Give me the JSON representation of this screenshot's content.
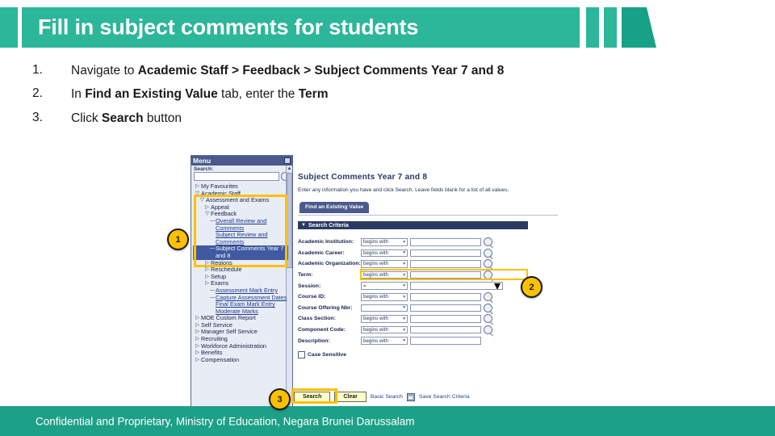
{
  "header": {
    "title": "Fill in subject comments for students",
    "brand_color": "#2cb69a",
    "accent_color": "#17a287"
  },
  "steps": [
    {
      "num": "1.",
      "html": "Navigate to <b>Academic Staff &gt; Feedback &gt; Subject Comments Year 7 and 8</b>"
    },
    {
      "num": "2.",
      "html": "In <b>Find an Existing Value</b> tab, enter the <b>Term</b>"
    },
    {
      "num": "3.",
      "html": "Click <b>Search</b> button"
    }
  ],
  "callouts": [
    {
      "label": "1"
    },
    {
      "label": "2"
    },
    {
      "label": "3"
    }
  ],
  "app": {
    "menu": {
      "title": "Menu",
      "search_label": "Search:",
      "search_value": "",
      "items": [
        {
          "label": "My Favourites",
          "glyph": "▷",
          "indent": 0,
          "style": "plain"
        },
        {
          "label": "Academic Staff",
          "glyph": "▽",
          "indent": 0,
          "style": "plain"
        },
        {
          "label": "Assessment and Exams",
          "glyph": "▽",
          "indent": 1,
          "style": "plain"
        },
        {
          "label": "Appeal",
          "glyph": "▷",
          "indent": 2,
          "style": "plain"
        },
        {
          "label": "Feedback",
          "glyph": "▽",
          "indent": 2,
          "style": "plain"
        },
        {
          "label": "Overall Review and Comments",
          "glyph": "—",
          "indent": 3,
          "style": "link"
        },
        {
          "label": "Subject Review and Comments",
          "glyph": "",
          "indent": 3,
          "style": "link"
        },
        {
          "label": "Subject Comments Year 7 and 8",
          "glyph": "—",
          "indent": 3,
          "style": "sel"
        },
        {
          "label": "Regions",
          "glyph": "▷",
          "indent": 2,
          "style": "plain"
        },
        {
          "label": "Reschedule",
          "glyph": "▷",
          "indent": 2,
          "style": "plain"
        },
        {
          "label": "Setup",
          "glyph": "▷",
          "indent": 2,
          "style": "plain"
        },
        {
          "label": "Exams",
          "glyph": "▷",
          "indent": 2,
          "style": "plain"
        },
        {
          "label": "Assessment Mark Entry",
          "glyph": "—",
          "indent": 3,
          "style": "link"
        },
        {
          "label": "Capture Assessment Dates",
          "glyph": "—",
          "indent": 3,
          "style": "link"
        },
        {
          "label": "Final Exam Mark Entry",
          "glyph": "",
          "indent": 3,
          "style": "link"
        },
        {
          "label": "Moderate Marks",
          "glyph": "",
          "indent": 3,
          "style": "link"
        },
        {
          "label": "MOE Custom Report",
          "glyph": "▷",
          "indent": 0,
          "style": "plain"
        },
        {
          "label": "Self Service",
          "glyph": "▷",
          "indent": 0,
          "style": "plain"
        },
        {
          "label": "Manager Self Service",
          "glyph": "▷",
          "indent": 0,
          "style": "plain"
        },
        {
          "label": "Recruiting",
          "glyph": "▷",
          "indent": 0,
          "style": "plain"
        },
        {
          "label": "Workforce Administration",
          "glyph": "▷",
          "indent": 0,
          "style": "plain"
        },
        {
          "label": "Benefits",
          "glyph": "▷",
          "indent": 0,
          "style": "plain"
        },
        {
          "label": "Compensation",
          "glyph": "▷",
          "indent": 0,
          "style": "plain"
        }
      ]
    },
    "content": {
      "title": "Subject Comments Year 7 and 8",
      "instructions": "Enter any information you have and click Search. Leave fields blank for a list of all values.",
      "tab_label": "Find an Existing Value",
      "criteria_header": "Search Criteria",
      "fields": [
        {
          "label": "Academic Institution:",
          "operator": "begins with",
          "value": "",
          "lookup": true,
          "wide": false
        },
        {
          "label": "Academic Career:",
          "operator": "begins with",
          "value": "",
          "lookup": true,
          "wide": false
        },
        {
          "label": "Academic Organization:",
          "operator": "begins with",
          "value": "",
          "lookup": true,
          "wide": false
        },
        {
          "label": "Term:",
          "operator": "begins with",
          "value": "",
          "lookup": true,
          "wide": false
        },
        {
          "label": "Session:",
          "operator": "=",
          "value": "",
          "lookup": false,
          "wide": true
        },
        {
          "label": "Course ID:",
          "operator": "begins with",
          "value": "",
          "lookup": true,
          "wide": false
        },
        {
          "label": "Course Offering Nbr:",
          "operator": "",
          "value": "",
          "lookup": true,
          "wide": false
        },
        {
          "label": "Class Section:",
          "operator": "begins with",
          "value": "",
          "lookup": true,
          "wide": false
        },
        {
          "label": "Component Code:",
          "operator": "begins with",
          "value": "",
          "lookup": true,
          "wide": false
        },
        {
          "label": "Description:",
          "operator": "begins with",
          "value": "",
          "lookup": false,
          "wide": false
        }
      ],
      "case_sensitive_label": "Case Sensitive",
      "buttons": {
        "search": "Search",
        "clear": "Clear",
        "basic_search": "Basic Search",
        "save_search": "Save Search Criteria"
      }
    }
  },
  "footer": {
    "text": "Confidential and Proprietary, Ministry of Education, Negara Brunei Darussalam",
    "color": "#1da088"
  }
}
